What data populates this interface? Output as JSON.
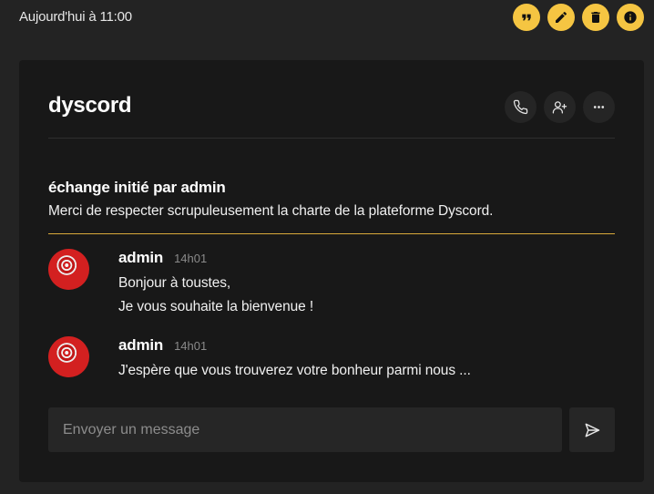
{
  "topbar": {
    "timestamp": "Aujourd'hui à 11:00",
    "actions": [
      {
        "icon": "quote-icon"
      },
      {
        "icon": "pencil-icon"
      },
      {
        "icon": "trash-icon"
      },
      {
        "icon": "info-icon"
      }
    ],
    "accent_color": "#f5c542"
  },
  "channel": {
    "title": "dyscord",
    "buttons": [
      {
        "icon": "phone-icon"
      },
      {
        "icon": "add-user-icon"
      },
      {
        "icon": "more-icon"
      }
    ]
  },
  "intro": {
    "title": "échange initié par admin",
    "text": "Merci de respecter scrupuleusement la charte de la plateforme Dyscord."
  },
  "messages": [
    {
      "author": "admin",
      "time": "14h01",
      "lines": [
        "Bonjour à toustes,",
        "Je vous souhaite la bienvenue !"
      ]
    },
    {
      "author": "admin",
      "time": "14h01",
      "lines": [
        "J'espère que vous trouverez votre bonheur parmi nous ..."
      ]
    }
  ],
  "composer": {
    "placeholder": "Envoyer un message",
    "value": ""
  }
}
